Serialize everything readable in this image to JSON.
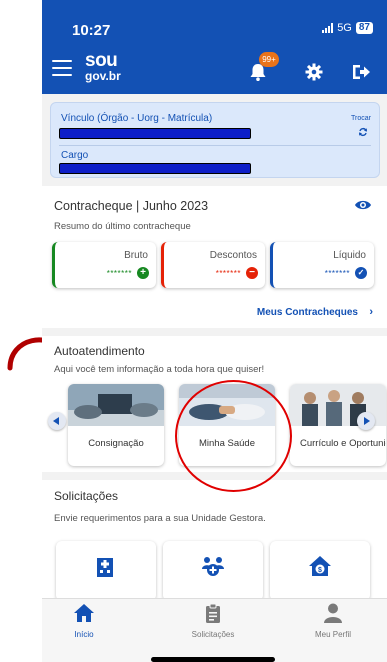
{
  "status": {
    "time": "10:27",
    "network": "5G",
    "battery": "87"
  },
  "header": {
    "logo_line1": "sou",
    "logo_line2": "gov.br",
    "notification_badge": "99+"
  },
  "vinculo": {
    "label": "Vínculo (Órgão - Uorg - Matrícula)",
    "trocar": "Trocar",
    "cargo_label": "Cargo"
  },
  "contracheque": {
    "title": "Contracheque | Junho 2023",
    "subtitle": "Resumo do último contracheque",
    "cards": [
      {
        "label": "Bruto",
        "mask": "*******",
        "color": "#168821",
        "icon": "plus-icon"
      },
      {
        "label": "Descontos",
        "mask": "*******",
        "color": "#e52207",
        "icon": "minus-icon"
      },
      {
        "label": "Líquido",
        "mask": "*******",
        "color": "#1351b4",
        "icon": "check-icon"
      }
    ],
    "link": "Meus Contracheques",
    "link_chevron": "›"
  },
  "autoatendimento": {
    "title": "Autoatendimento",
    "subtitle": "Aqui você tem informação a toda hora que quiser!",
    "services": [
      {
        "label": "Consignação"
      },
      {
        "label": "Minha Saúde"
      },
      {
        "label": "Currículo e Oportunidades"
      }
    ]
  },
  "solicitacoes": {
    "title": "Solicitações",
    "subtitle": "Envie requerimentos para a sua Unidade Gestora."
  },
  "bottom_nav": {
    "items": [
      {
        "label": "Início",
        "icon": "home-icon"
      },
      {
        "label": "Solicitações",
        "icon": "clipboard-icon"
      },
      {
        "label": "Meu Perfil",
        "icon": "user-icon"
      }
    ]
  },
  "colors": {
    "primary": "#1351b4",
    "annotation": "#e00000"
  }
}
